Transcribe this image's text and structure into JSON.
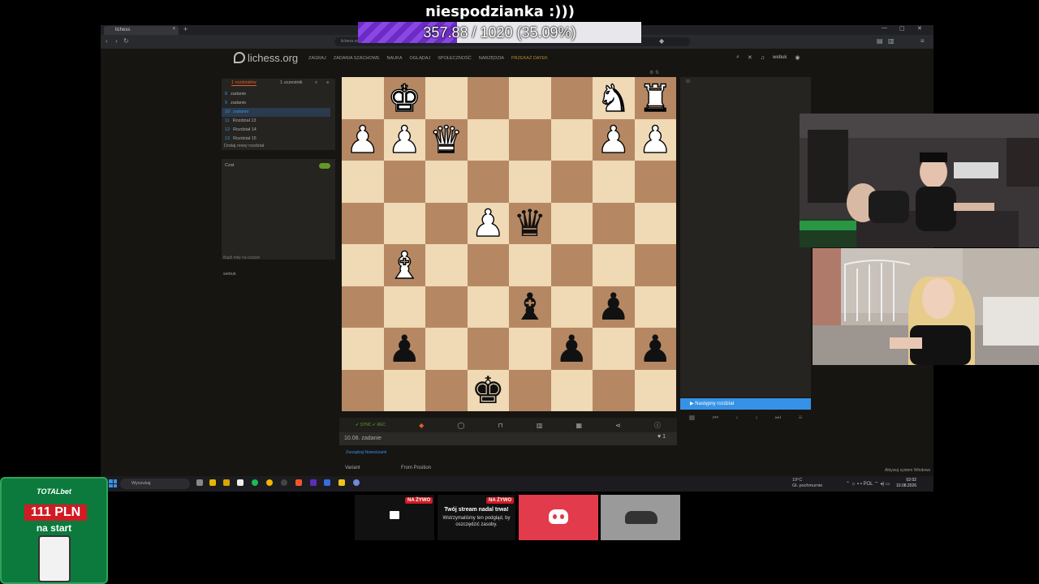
{
  "overlay": {
    "title": "niespodzianka :)))",
    "progress_text": "357.88 / 1020 (35.09%)",
    "progress_fraction": 0.3509
  },
  "browser": {
    "tab_title": "lichess",
    "tab_close": "×",
    "newtab": "+",
    "url": "lichess.org/study",
    "win_controls": [
      "—",
      "▢",
      "✕"
    ]
  },
  "lichess": {
    "logo": "lichess.org",
    "nav": [
      "ZAGRAJ",
      "ZADANIA SZACHOWE",
      "NAUKA",
      "OGLĄDAJ",
      "SPOŁECZNOŚĆ",
      "NARZĘDZIA"
    ],
    "donate": "PRZEKAŻ DATEK",
    "username": "webuk",
    "study_tabs": [
      "1 rozdziałów",
      "1 uczestnik"
    ],
    "chapters": [
      {
        "num": "8",
        "name": "zadanie",
        "active": false
      },
      {
        "num": "9",
        "name": "zadanie",
        "active": false
      },
      {
        "num": "10",
        "name": "zadanie",
        "active": true
      },
      {
        "num": "11",
        "name": "Rozdział 13",
        "active": false
      },
      {
        "num": "12",
        "name": "Rozdział 14",
        "active": false
      },
      {
        "num": "13",
        "name": "Rozdział 15",
        "active": false
      }
    ],
    "add_chapter": "Dodaj nowy rozdział",
    "chat_label": "Czat",
    "chat_footer": "Bądź miły na czacie!",
    "members": "webuk",
    "next_chapter": "Następny rozdział",
    "sync": "SYNC",
    "rec": "REC",
    "study_name": "10.08. zadanie",
    "likes": "1",
    "edit_link": "Zarządzaj Nowościami",
    "variant_label": "Variant",
    "variant_value": "From Position",
    "board": [
      [
        "",
        "K",
        "",
        "",
        "",
        "",
        "N",
        "R"
      ],
      [
        "P",
        "P",
        "Q",
        "",
        "",
        "",
        "P",
        "P"
      ],
      [
        "",
        "",
        "",
        "",
        "",
        "",
        "",
        ""
      ],
      [
        "",
        "",
        "",
        "P",
        "q",
        "",
        "",
        ""
      ],
      [
        "",
        "B",
        "",
        "",
        "",
        "",
        "",
        ""
      ],
      [
        "",
        "",
        "",
        "",
        "b",
        "",
        "p",
        ""
      ],
      [
        "",
        "p",
        "",
        "",
        "",
        "p",
        "",
        "p"
      ],
      [
        "",
        "",
        "",
        "k",
        "",
        "",
        "",
        ""
      ]
    ]
  },
  "taskbar": {
    "search_placeholder": "Wyszukaj",
    "weather_temp": "19°C",
    "weather_desc": "Gł. pochmurnie",
    "lang": "POL",
    "time": "02:02",
    "date": "10.08.2026",
    "notice": "Aktywuj system Windows"
  },
  "promo": {
    "brand": "TOTALbet",
    "amount": "111 PLN",
    "sub": "na start"
  },
  "cards": {
    "live_badge": "NA ŻYWO",
    "stream_title": "Twój stream nadal trwa!",
    "stream_desc": "Wstrzymaliśmy ten podgląd, by oszczędzić zasoby."
  },
  "colors": {
    "light_square": "#f0d9b5",
    "dark_square": "#b58863",
    "accent_blue": "#3692e7",
    "progress_purple": "#7b38d6"
  }
}
